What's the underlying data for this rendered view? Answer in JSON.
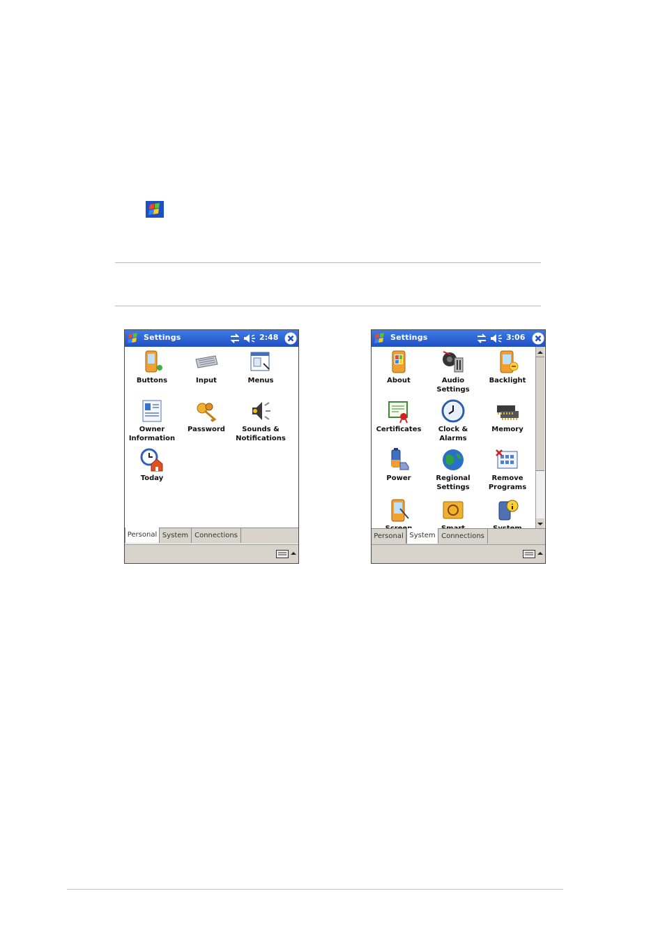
{
  "colors": {
    "titlebar": "#2a5fd6",
    "tabbar": "#d8d4cc",
    "rule": "#b8b8b8"
  },
  "screens": [
    {
      "title": "Settings",
      "time": "2:48",
      "active_tab": "Personal",
      "tabs": [
        "Personal",
        "System",
        "Connections"
      ],
      "icons": [
        {
          "label": "Buttons",
          "icon": "buttons-icon"
        },
        {
          "label": "Input",
          "icon": "input-keyboard-icon"
        },
        {
          "label": "Menus",
          "icon": "menus-icon"
        },
        {
          "label": "Owner\nInformation",
          "icon": "owner-information-icon"
        },
        {
          "label": "Password",
          "icon": "password-keys-icon"
        },
        {
          "label": "Sounds &\nNotifications",
          "icon": "sounds-speaker-icon"
        },
        {
          "label": "Today",
          "icon": "today-clock-home-icon"
        }
      ]
    },
    {
      "title": "Settings",
      "time": "3:06",
      "active_tab": "System",
      "tabs": [
        "Personal",
        "System",
        "Connections"
      ],
      "icons": [
        {
          "label": "About",
          "icon": "about-icon"
        },
        {
          "label": "Audio\nSettings",
          "icon": "audio-settings-icon"
        },
        {
          "label": "Backlight",
          "icon": "backlight-icon"
        },
        {
          "label": "Certificates",
          "icon": "certificates-icon"
        },
        {
          "label": "Clock &\nAlarms",
          "icon": "clock-icon"
        },
        {
          "label": "Memory",
          "icon": "memory-icon"
        },
        {
          "label": "Power",
          "icon": "power-battery-icon"
        },
        {
          "label": "Regional\nSettings",
          "icon": "globe-icon"
        },
        {
          "label": "Remove\nPrograms",
          "icon": "remove-programs-icon"
        },
        {
          "label": "Screen",
          "icon": "screen-icon"
        },
        {
          "label": "Smart",
          "icon": "smart-icon"
        },
        {
          "label": "System",
          "icon": "system-info-icon"
        }
      ]
    }
  ]
}
